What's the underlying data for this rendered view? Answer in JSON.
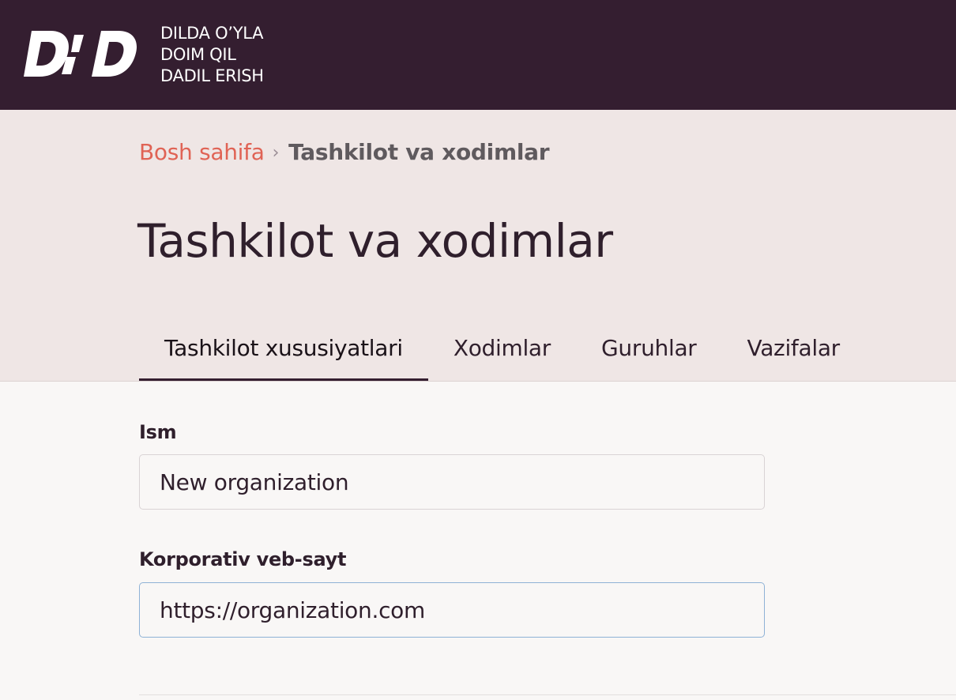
{
  "header": {
    "logo_icon": "ddd-logo-icon",
    "tagline": [
      "DILDA O’YLA",
      "DOIM QIL",
      "DADIL ERISH"
    ],
    "bg_color": "#341e30"
  },
  "breadcrumb": {
    "home": "Bosh sahifa",
    "separator": "›",
    "current": "Tashkilot va xodimlar"
  },
  "page": {
    "title": "Tashkilot va xodimlar"
  },
  "tabs": [
    {
      "label": "Tashkilot xususiyatlari",
      "active": true
    },
    {
      "label": "Xodimlar",
      "active": false
    },
    {
      "label": "Guruhlar",
      "active": false
    },
    {
      "label": "Vazifalar",
      "active": false
    }
  ],
  "form": {
    "name": {
      "label": "Ism",
      "value": "New organization"
    },
    "website": {
      "label": "Korporativ veb-sayt",
      "value": "https://organization.com",
      "focused": true
    }
  },
  "colors": {
    "accent_link": "#e06355",
    "hero_bg": "#efe6e5",
    "page_bg": "#f9f7f6",
    "focus_border": "#8fb2d6"
  }
}
